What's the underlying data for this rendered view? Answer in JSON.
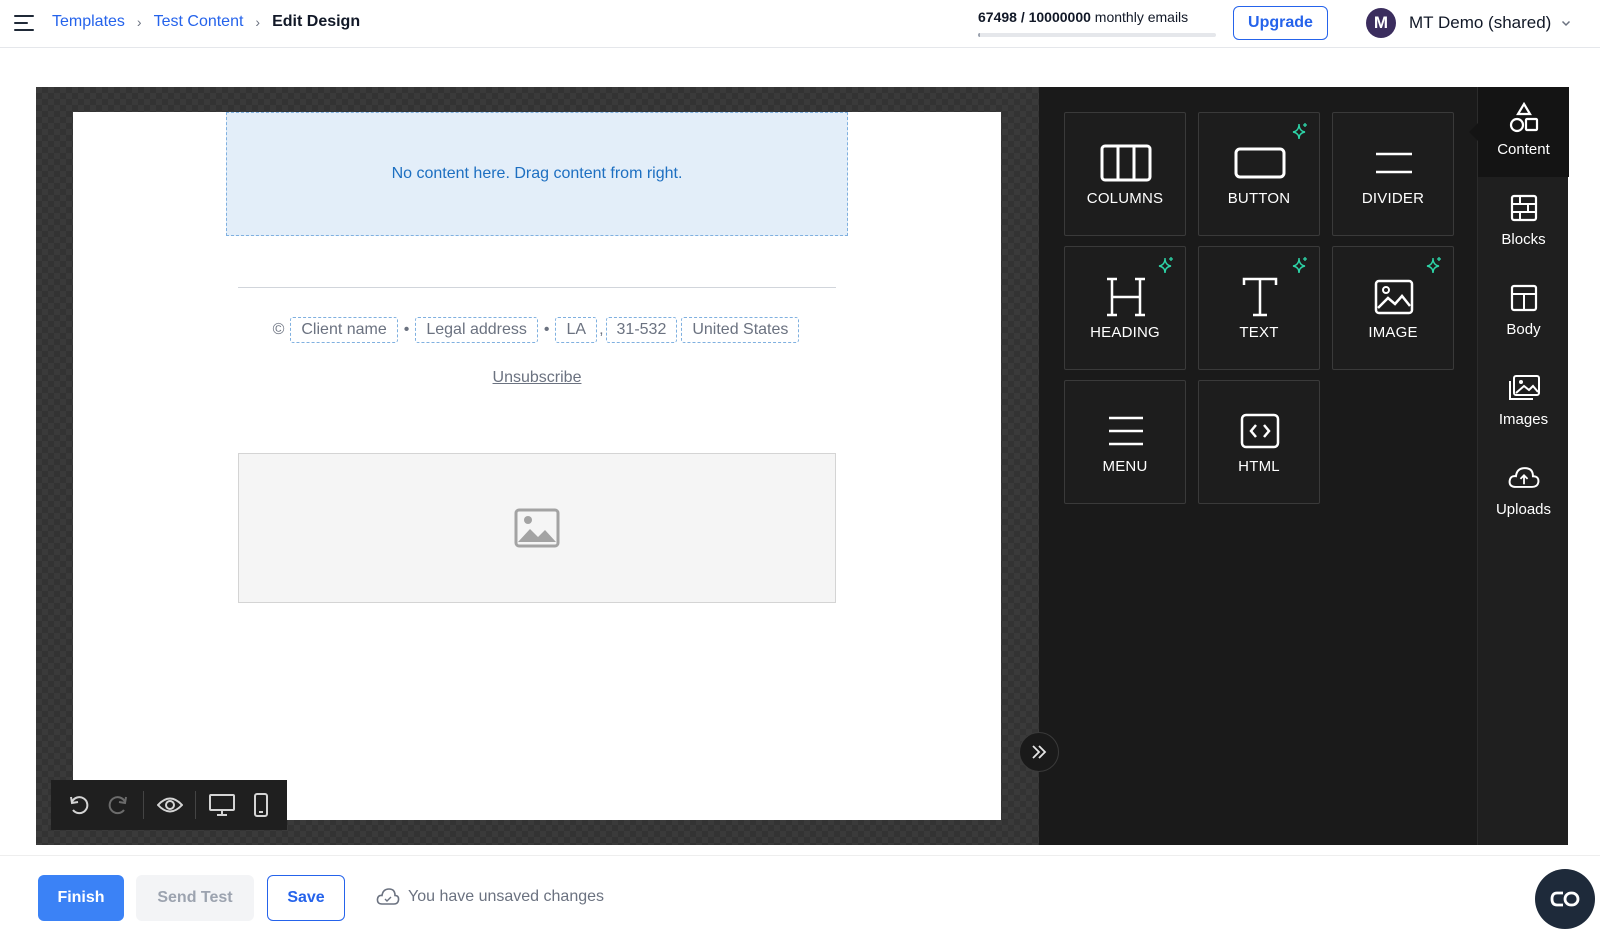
{
  "header": {
    "breadcrumb": [
      {
        "label": "Templates"
      },
      {
        "label": "Test Content"
      }
    ],
    "breadcrumb_sep": "›",
    "current_page": "Edit Design",
    "usage": {
      "used": "67498",
      "limit": "10000000",
      "separator": " / ",
      "suffix": " monthly emails",
      "fraction": 0.0067
    },
    "upgrade_label": "Upgrade",
    "account": {
      "initial": "M",
      "name": "MT Demo (shared)"
    }
  },
  "canvas": {
    "empty_row_text": "No content here. Drag content from right.",
    "footer": {
      "copyright": "©",
      "client_name": "Client name",
      "legal_address": "Legal address",
      "state": "LA",
      "zip": "31-532",
      "country": "United States",
      "dot": "•",
      "comma": ","
    },
    "unsubscribe": "Unsubscribe"
  },
  "tiles": [
    {
      "label": "COLUMNS",
      "icon": "columns-icon",
      "ai": false
    },
    {
      "label": "BUTTON",
      "icon": "button-icon",
      "ai": true
    },
    {
      "label": "DIVIDER",
      "icon": "divider-icon",
      "ai": false
    },
    {
      "label": "HEADING",
      "icon": "heading-icon",
      "ai": true
    },
    {
      "label": "TEXT",
      "icon": "text-icon",
      "ai": true
    },
    {
      "label": "IMAGE",
      "icon": "image-icon",
      "ai": true
    },
    {
      "label": "MENU",
      "icon": "menu-icon",
      "ai": false
    },
    {
      "label": "HTML",
      "icon": "html-icon",
      "ai": false
    }
  ],
  "side_tabs": [
    {
      "label": "Content",
      "icon": "shapes-icon",
      "active": true
    },
    {
      "label": "Blocks",
      "icon": "blocks-icon",
      "active": false
    },
    {
      "label": "Body",
      "icon": "body-layout-icon",
      "active": false
    },
    {
      "label": "Images",
      "icon": "images-icon",
      "active": false
    },
    {
      "label": "Uploads",
      "icon": "cloud-upload-icon",
      "active": false
    }
  ],
  "footer_bar": {
    "finish_label": "Finish",
    "send_test_label": "Send Test",
    "save_label": "Save",
    "unsaved_text": "You have unsaved changes"
  },
  "colors": {
    "accent": "#2563eb",
    "primary_button": "#3b82f6",
    "ai_sparkle": "#2dd4a7",
    "editor_bg": "#1a1a1a"
  }
}
